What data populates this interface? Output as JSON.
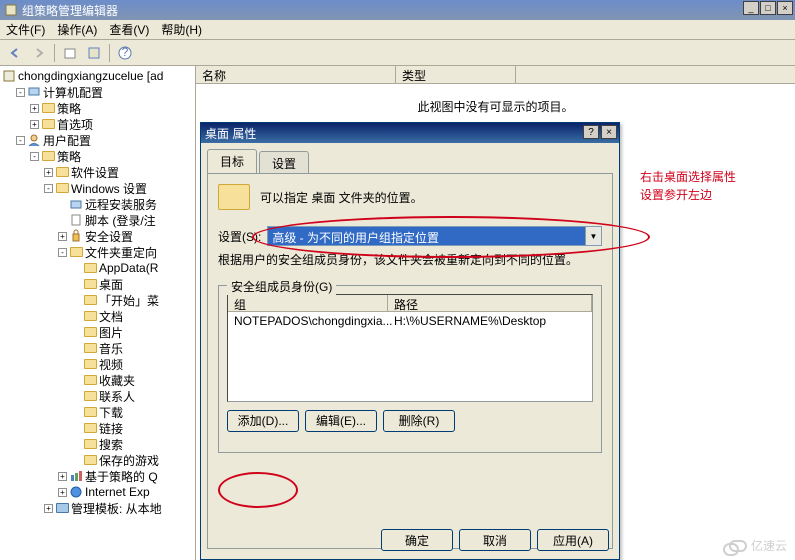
{
  "window": {
    "title": "组策略管理编辑器",
    "controls": {
      "min": "_",
      "max": "□",
      "close": "×"
    }
  },
  "menu": {
    "file": "文件(F)",
    "action": "操作(A)",
    "view": "查看(V)",
    "help": "帮助(H)"
  },
  "tree": {
    "root": "chongdingxiangzucelue [ad",
    "computerConfig": "计算机配置",
    "policy": "策略",
    "preferences": "首选项",
    "userConfig": "用户配置",
    "policy2": "策略",
    "softwareSettings": "软件设置",
    "windowsSettings": "Windows 设置",
    "remoteInstall": "远程安装服务",
    "scripts": "脚本 (登录/注",
    "securitySettings": "安全设置",
    "folderRedirect": "文件夹重定向",
    "appdata": "AppData(R",
    "desktop": "桌面",
    "startMenu": "「开始」菜",
    "documents": "文档",
    "pictures": "图片",
    "music": "音乐",
    "videos": "视频",
    "favorites": "收藏夹",
    "contacts": "联系人",
    "downloads": "下载",
    "links": "链接",
    "searches": "搜索",
    "savedGames": "保存的游戏",
    "policyBasedQos": "基于策略的 Q",
    "ieMaint": "Internet Exp",
    "adminTemplates": "管理模板: 从本地"
  },
  "list": {
    "col_name": "名称",
    "col_type": "类型",
    "empty": "此视图中没有可显示的项目。"
  },
  "dialog": {
    "title": "桌面 属性",
    "help_btn": "?",
    "close_btn": "×",
    "tab_target": "目标",
    "tab_settings": "设置",
    "intro": "可以指定 桌面 文件夹的位置。",
    "setting_label": "设置(S):",
    "combo_value": "高级 - 为不同的用户组指定位置",
    "note": "根据用户的安全组成员身份，该文件夹会被重新定向到不同的位置。",
    "group_legend": "安全组成员身份(G)",
    "col_group": "组",
    "col_path": "路径",
    "row_group": "NOTEPADOS\\chongdingxia...",
    "row_path": "H:\\%USERNAME%\\Desktop",
    "btn_add": "添加(D)...",
    "btn_edit": "编辑(E)...",
    "btn_remove": "删除(R)",
    "btn_ok": "确定",
    "btn_cancel": "取消",
    "btn_apply": "应用(A)"
  },
  "annotation": {
    "line1": "右击桌面选择属性",
    "line2": "设置参开左边"
  },
  "watermark": "亿速云"
}
